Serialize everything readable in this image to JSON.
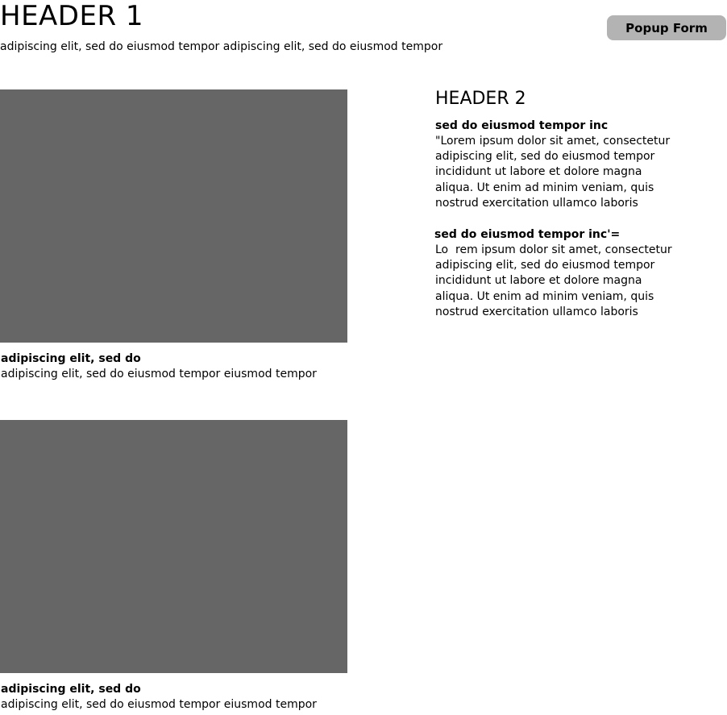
{
  "header": {
    "title": "HEADER 1",
    "subtitle": "adipiscing elit, sed do eiusmod tempor adipiscing elit, sed do eiusmod tempor",
    "popup_button_label": "Popup Form"
  },
  "media": [
    {
      "caption_title": "adipiscing elit, sed do",
      "caption_text": "adipiscing elit, sed do eiusmod tempor eiusmod tempor"
    },
    {
      "caption_title": "adipiscing elit, sed do",
      "caption_text": "adipiscing elit, sed do eiusmod tempor eiusmod tempor"
    }
  ],
  "side": {
    "title": "HEADER 2",
    "blocks": [
      {
        "title": "sed do eiusmod tempor inc",
        "lines": [
          "\"Lorem ipsum dolor sit amet, consectetur",
          "adipiscing elit, sed do eiusmod tempor",
          "incididunt ut labore et dolore magna",
          "aliqua. Ut enim ad minim veniam, quis",
          "nostrud exercitation ullamco laboris"
        ]
      },
      {
        "title": "sed do eiusmod tempor inc'=",
        "lines": [
          "Lo  rem ipsum dolor sit amet, consectetur",
          "adipiscing elit, sed do eiusmod tempor",
          "incididunt ut labore et dolore magna",
          "aliqua. Ut enim ad minim veniam, quis",
          "nostrud exercitation ullamco laboris"
        ]
      }
    ]
  },
  "colors": {
    "placeholder": "#666666",
    "button_bg": "#b3b3b3",
    "text": "#000000"
  }
}
